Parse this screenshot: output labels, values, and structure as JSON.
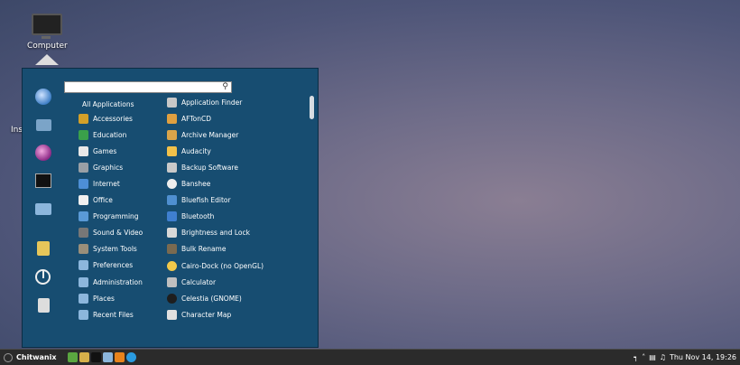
{
  "desktop": {
    "icons": [
      {
        "label": "Computer"
      },
      {
        "label": ""
      }
    ],
    "partial_label": "Ins"
  },
  "menu": {
    "search": {
      "value": "",
      "placeholder": ""
    },
    "categories": [
      {
        "label": "All Applications",
        "icon": "none"
      },
      {
        "label": "Accessories",
        "icon": "accessories-icon",
        "color": "#d4a028"
      },
      {
        "label": "Education",
        "icon": "education-icon",
        "color": "#3aa04a"
      },
      {
        "label": "Games",
        "icon": "games-icon",
        "color": "#e8e8e8"
      },
      {
        "label": "Graphics",
        "icon": "graphics-icon",
        "color": "#9aa0a6"
      },
      {
        "label": "Internet",
        "icon": "internet-icon",
        "color": "#4d8fd6"
      },
      {
        "label": "Office",
        "icon": "office-icon",
        "color": "#f0f0f0"
      },
      {
        "label": "Programming",
        "icon": "programming-icon",
        "color": "#5a9ad6"
      },
      {
        "label": "Sound & Video",
        "icon": "sound-video-icon",
        "color": "#777"
      },
      {
        "label": "System Tools",
        "icon": "system-tools-icon",
        "color": "#9a8f7a"
      },
      {
        "label": "Preferences",
        "icon": "preferences-folder-icon",
        "color": "#8cb6dc"
      },
      {
        "label": "Administration",
        "icon": "administration-folder-icon",
        "color": "#8cb6dc"
      },
      {
        "label": "Places",
        "icon": "places-folder-icon",
        "color": "#8cb6dc"
      },
      {
        "label": "Recent Files",
        "icon": "recent-files-folder-icon",
        "color": "#8cb6dc"
      }
    ],
    "apps": [
      {
        "label": "Application Finder",
        "icon": "application-finder-icon",
        "color": "#c8c8c8"
      },
      {
        "label": "AFTonCD",
        "icon": "aftoncd-icon",
        "color": "#e0a040"
      },
      {
        "label": "Archive Manager",
        "icon": "archive-manager-icon",
        "color": "#d9a44a"
      },
      {
        "label": "Audacity",
        "icon": "audacity-icon",
        "color": "#f2c14a"
      },
      {
        "label": "Backup Software",
        "icon": "backup-software-icon",
        "color": "#c9c9c9"
      },
      {
        "label": "Banshee",
        "icon": "banshee-icon",
        "color": "#eeeeee"
      },
      {
        "label": "Bluefish Editor",
        "icon": "bluefish-icon",
        "color": "#4f8fd0"
      },
      {
        "label": "Bluetooth",
        "icon": "bluetooth-icon",
        "color": "#3f7fd0"
      },
      {
        "label": "Brightness and Lock",
        "icon": "brightness-lock-icon",
        "color": "#d8d8d8"
      },
      {
        "label": "Bulk Rename",
        "icon": "bulk-rename-icon",
        "color": "#7a6a50"
      },
      {
        "label": "Cairo-Dock (no OpenGL)",
        "icon": "cairo-dock-icon",
        "color": "#f2c94a"
      },
      {
        "label": "Calculator",
        "icon": "calculator-icon",
        "color": "#bfbfbf"
      },
      {
        "label": "Celestia (GNOME)",
        "icon": "celestia-icon",
        "color": "#1e1e1e"
      },
      {
        "label": "Character Map",
        "icon": "character-map-icon",
        "color": "#e0e0e0"
      }
    ]
  },
  "panel": {
    "menu_label": "Chitwanix",
    "launchers": [
      {
        "icon": "system-monitor-icon",
        "color": "#5aa640"
      },
      {
        "icon": "text-editor-icon",
        "color": "#d6b04a"
      },
      {
        "icon": "terminal-icon",
        "color": "#111111"
      },
      {
        "icon": "file-manager-icon",
        "color": "#8cb6dc"
      },
      {
        "icon": "vlc-icon",
        "color": "#e8831c"
      },
      {
        "icon": "skype-icon",
        "color": "#2a9be0"
      }
    ],
    "clock": "Thu Nov 14, 19:26"
  }
}
